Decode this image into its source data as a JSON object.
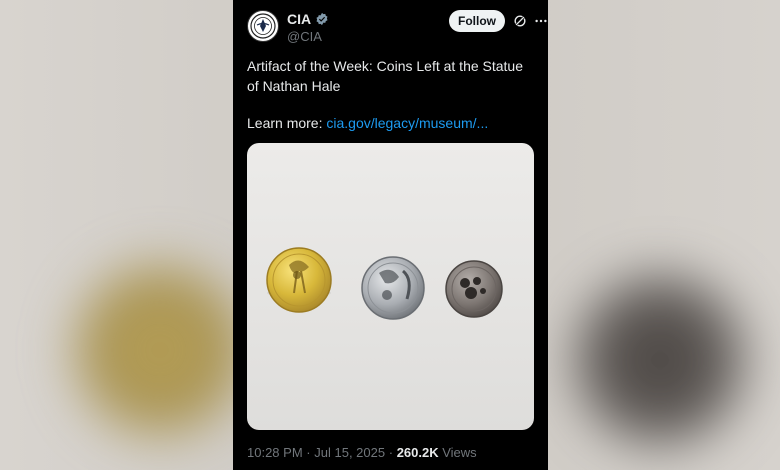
{
  "post": {
    "author_name": "CIA",
    "author_handle": "@CIA",
    "follow_label": "Follow",
    "more_label": "···",
    "text_line": "Artifact of the Week: Coins Left at the Statue of Nathan Hale",
    "learn_more_prefix": "Learn more: ",
    "learn_more_link": "cia.gov/legacy/museum/...",
    "time": "10:28 PM",
    "date": "Jul 15, 2025",
    "views_count": "260.2K",
    "views_label": "Views",
    "separator": "·"
  },
  "icons": {
    "verified": "verified-badge-icon",
    "grok": "grok-icon",
    "more": "more-icon"
  },
  "colors": {
    "background": "#000000",
    "text": "#e7e9ea",
    "muted": "#71767b",
    "link": "#1d9bf0",
    "follow_bg": "#eff3f4"
  }
}
